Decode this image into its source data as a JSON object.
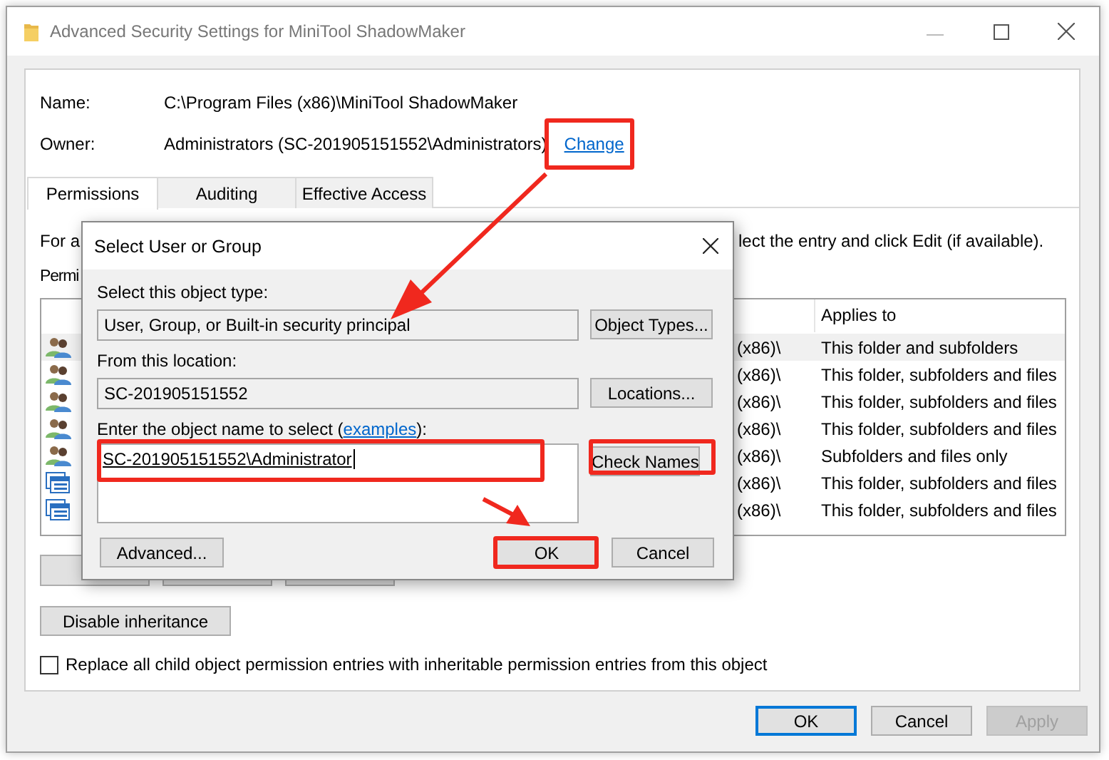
{
  "window": {
    "title": "Advanced Security Settings for MiniTool ShadowMaker"
  },
  "details": [
    {
      "label": "Name:",
      "value": "C:\\Program Files (x86)\\MiniTool ShadowMaker"
    },
    {
      "label": "Owner:",
      "value": "Administrators (SC-201905151552\\Administrators)",
      "link": "Change",
      "highlighted": true
    }
  ],
  "tabs": [
    {
      "label": "Permissions",
      "selected": true
    },
    {
      "label": "Auditing",
      "selected": false
    },
    {
      "label": "Effective Access",
      "selected": false
    }
  ],
  "instruction_start": "For a",
  "instruction_end": "lect the entry and click Edit (if available).",
  "list_label": "Permi",
  "table": {
    "columns": [
      "Applies to"
    ],
    "rows": [
      {
        "kind": "group",
        "column_3": "(x86)\\",
        "applies_to": "This folder and subfolders",
        "selected": true
      },
      {
        "kind": "group",
        "column_3": "(x86)\\",
        "applies_to": "This folder, subfolders and files",
        "selected": false
      },
      {
        "kind": "group",
        "column_3": "(x86)\\",
        "applies_to": "This folder, subfolders and files",
        "selected": false
      },
      {
        "kind": "group",
        "column_3": "(x86)\\",
        "applies_to": "This folder, subfolders and files",
        "selected": false
      },
      {
        "kind": "group",
        "column_3": "(x86)\\",
        "applies_to": "Subfolders and files only",
        "selected": false
      },
      {
        "kind": "app",
        "column_3": "(x86)\\",
        "applies_to": "This folder, subfolders and files",
        "selected": false
      },
      {
        "kind": "app",
        "column_3": "(x86)\\",
        "applies_to": "This folder, subfolders and files",
        "selected": false
      }
    ]
  },
  "disable_button": "Disable inheritance",
  "replace_option": {
    "label": "Replace all child object permission entries with inheritable permission entries from this object",
    "checked": false
  },
  "footer_buttons": [
    {
      "label": "OK",
      "default": true,
      "disabled": false
    },
    {
      "label": "Cancel",
      "default": false,
      "disabled": false
    },
    {
      "label": "Apply",
      "default": false,
      "disabled": true
    }
  ],
  "dialog": {
    "title": "Select User or Group",
    "type_label": "Select this object type:",
    "type_value": "User, Group, or Built-in security principal",
    "type_button": "Object Types...",
    "location_label": "From this location:",
    "location_value": "SC-201905151552",
    "location_button": "Locations...",
    "name_label_start": "Enter the object name to select (",
    "name_link": "examples",
    "name_label_end": "):",
    "name_value": "SC-201905151552\\Administrator",
    "name_highlighted": true,
    "check_button": "Check Names",
    "check_highlighted": true,
    "advanced_button": "Advanced...",
    "ok_button": "OK",
    "ok_highlighted": true,
    "cancel_button": "Cancel"
  }
}
